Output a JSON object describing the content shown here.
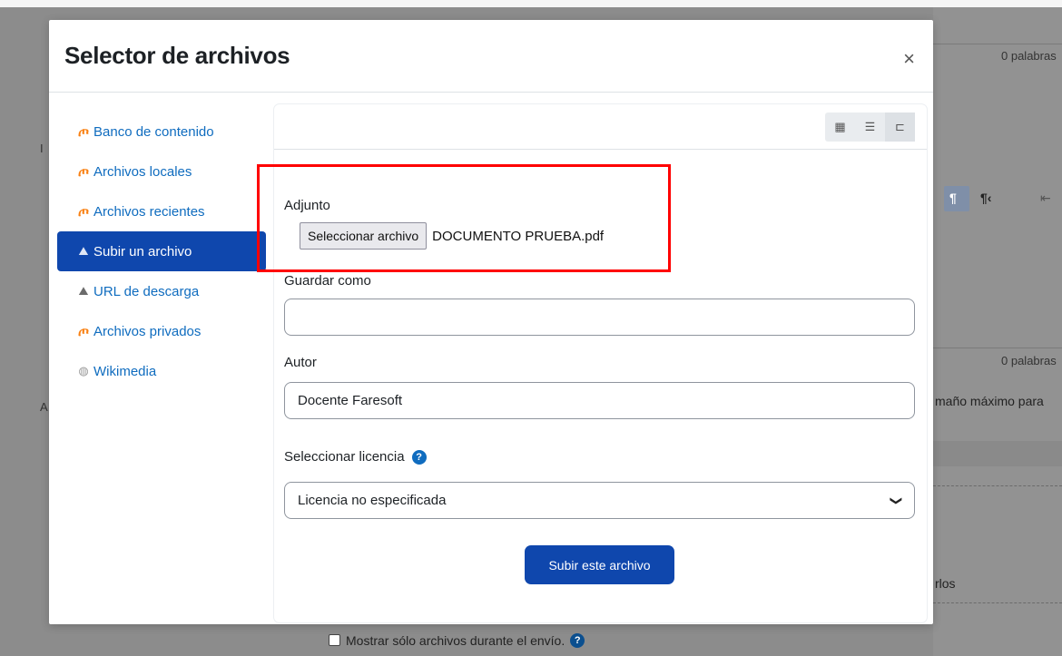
{
  "background": {
    "word_count_top": "0 palabras",
    "word_count_mid": "0 palabras",
    "fragment_left_1": "I",
    "fragment_left_2": "A",
    "max_size_fragment": "maño máximo para",
    "fragment_rlos": "rlos",
    "toolbar_pilcrow_rtl": "¶",
    "toolbar_pilcrow_ltr": "¶‹",
    "show_only_files_label": "Mostrar sólo archivos durante el envío.",
    "help_symbol": "?"
  },
  "modal": {
    "title": "Selector de archivos",
    "close_symbol": "×"
  },
  "sidebar": {
    "items": [
      {
        "label": "Banco de contenido",
        "icon": "moodle-icon",
        "glyph": "ጦ"
      },
      {
        "label": "Archivos locales",
        "icon": "moodle-icon",
        "glyph": "ጦ"
      },
      {
        "label": "Archivos recientes",
        "icon": "moodle-icon",
        "glyph": "ጦ"
      },
      {
        "label": "Subir un archivo",
        "icon": "upload-icon",
        "glyph": "⛰",
        "active": true
      },
      {
        "label": "URL de descarga",
        "icon": "url-download-icon",
        "glyph": "⛰"
      },
      {
        "label": "Archivos privados",
        "icon": "moodle-icon",
        "glyph": "ጦ"
      },
      {
        "label": "Wikimedia",
        "icon": "wikimedia-icon",
        "glyph": "◍"
      }
    ]
  },
  "view_buttons": {
    "icons": "▦",
    "list": "☰",
    "tree": "⊏"
  },
  "form": {
    "attachment_label": "Adjunto",
    "choose_file_button": "Seleccionar archivo",
    "chosen_file": "DOCUMENTO PRUEBA.pdf",
    "save_as_label": "Guardar como",
    "save_as_value": "",
    "author_label": "Autor",
    "author_value": "Docente Faresoft",
    "license_label": "Seleccionar licencia",
    "license_value": "Licencia no especificada",
    "submit_label": "Subir este archivo"
  },
  "colors": {
    "primary": "#0f47ad",
    "link": "#0f6cbf",
    "highlight": "#ff0000"
  }
}
